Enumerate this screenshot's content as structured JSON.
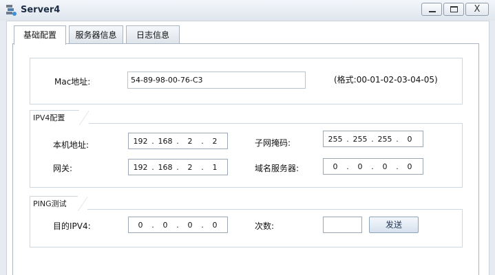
{
  "window": {
    "title": "Server4",
    "icon": "server-icon",
    "min_icon": "minimize-icon",
    "max_icon": "maximize-icon",
    "close_icon": "close-icon",
    "close_glyph": "X"
  },
  "tabs": [
    {
      "label": "基础配置",
      "active": true
    },
    {
      "label": "服务器信息",
      "active": false
    },
    {
      "label": "日志信息",
      "active": false
    }
  ],
  "mac": {
    "label": "Mac地址:",
    "value": "54-89-98-00-76-C3",
    "format_hint": "(格式:00-01-02-03-04-05)"
  },
  "ipv4": {
    "section_title": "IPV4配置",
    "local_ip": {
      "label": "本机地址:",
      "octets": [
        "192",
        "168",
        "2",
        "2"
      ]
    },
    "subnet_mask": {
      "label": "子网掩码:",
      "octets": [
        "255",
        "255",
        "255",
        "0"
      ]
    },
    "gateway": {
      "label": "网关:",
      "octets": [
        "192",
        "168",
        "2",
        "1"
      ]
    },
    "dns": {
      "label": "域名服务器:",
      "octets": [
        "0",
        "0",
        "0",
        "0"
      ]
    }
  },
  "ping": {
    "section_title": "PING测试",
    "target": {
      "label": "目的IPV4:",
      "octets": [
        "0",
        "0",
        "0",
        "0"
      ]
    },
    "count": {
      "label": "次数:",
      "value": ""
    },
    "send_label": "发送"
  },
  "ip_separator": "."
}
